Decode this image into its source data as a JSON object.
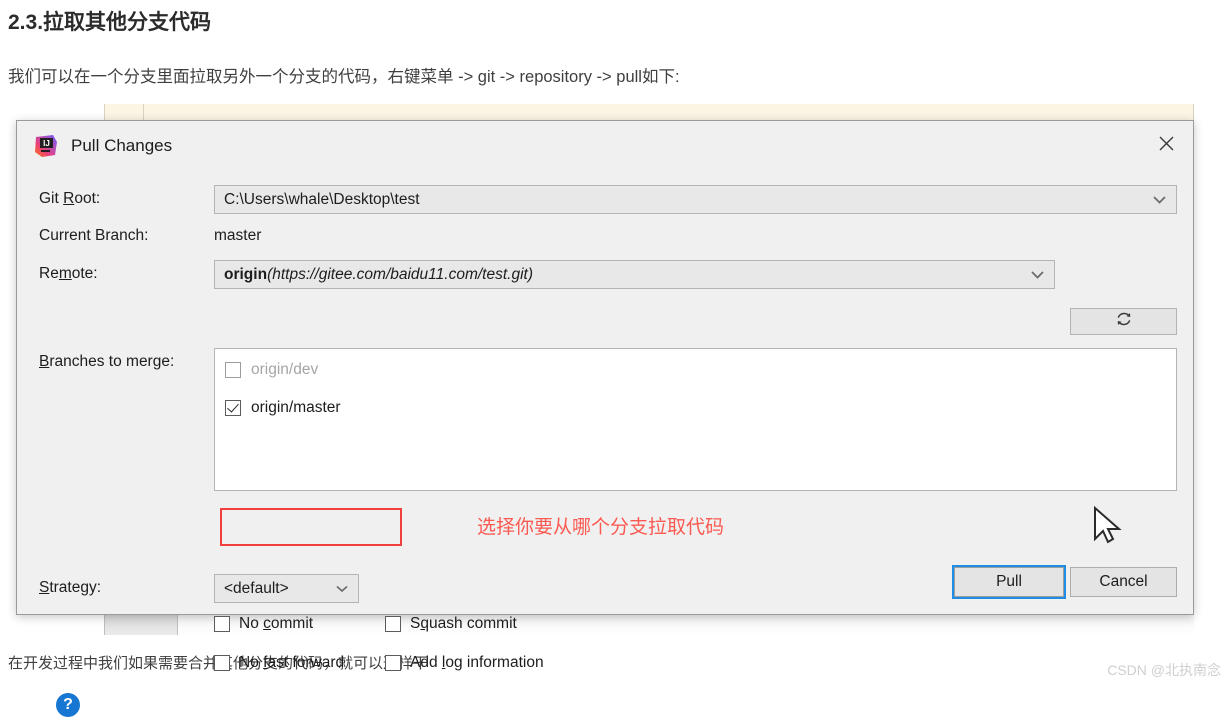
{
  "article": {
    "heading": "2.3.拉取其他分支代码",
    "paragraph": "我们可以在一个分支里面拉取另外一个分支的代码，右键菜单 -> git -> repository -> pull如下:",
    "footer": "在开发过程中我们如果需要合并其他分支的代码，就可以这样干",
    "watermark": "CSDN @北执南念"
  },
  "dialog": {
    "title": "Pull Changes",
    "app_icon": "intellij-idea-icon",
    "close_icon": "close-icon",
    "fields": {
      "git_root_label": "Git Root:",
      "git_root_label_pre": "Git ",
      "git_root_label_mnemonic": "R",
      "git_root_label_post": "oot:",
      "git_root_value": "C:\\Users\\whale\\Desktop\\test",
      "current_branch_label": "Current Branch:",
      "current_branch_value": "master",
      "remote_label_pre": "Re",
      "remote_label_mnemonic": "m",
      "remote_label_post": "ote:",
      "remote_value_name": "origin",
      "remote_value_url": "(https://gitee.com/baidu11.com/test.git)",
      "refresh_icon": "refresh-icon",
      "branches_label_pre": "",
      "branches_label_mnemonic": "B",
      "branches_label_post": "ranches to merge:",
      "strategy_label_pre": "",
      "strategy_label_mnemonic": "S",
      "strategy_label_post": "trategy:",
      "strategy_value": "<default>"
    },
    "branches": [
      {
        "name": "origin/dev",
        "checked": false,
        "enabled": false
      },
      {
        "name": "origin/master",
        "checked": true,
        "enabled": true
      }
    ],
    "options": [
      {
        "pre": "No ",
        "mnemonic": "c",
        "post": "ommit",
        "checked": false
      },
      {
        "pre": "S",
        "mnemonic": "q",
        "post": "uash commit",
        "checked": false
      },
      {
        "pre": "No ",
        "mnemonic": "f",
        "post": "ast forward",
        "checked": false
      },
      {
        "pre": "Add ",
        "mnemonic": "l",
        "post": "og information",
        "checked": false
      }
    ],
    "footer": {
      "help_label": "?",
      "pull_label": "Pull",
      "cancel_label": "Cancel"
    }
  },
  "annotation": {
    "text": "选择你要从哪个分支拉取代码",
    "color": "#fb5a52"
  },
  "colors": {
    "dialog_bg": "#f0f0f0",
    "accent_blue": "#1f8ce8",
    "help_blue": "#1676d2",
    "annotation_red": "#f1403c"
  }
}
